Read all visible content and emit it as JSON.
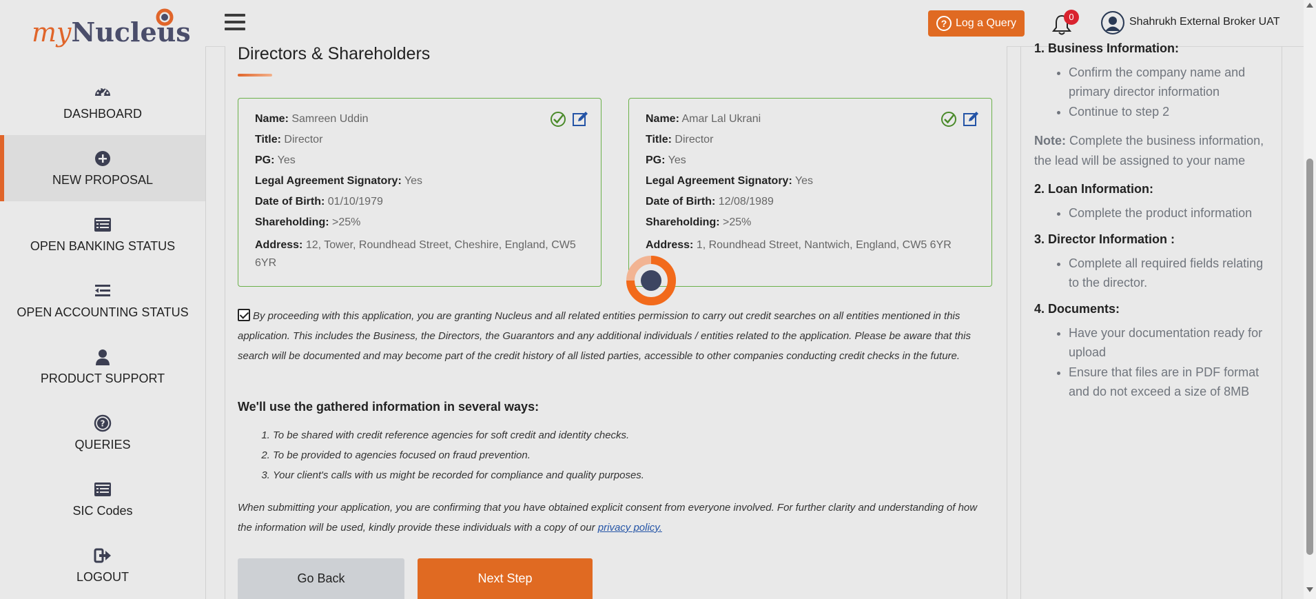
{
  "logo": {
    "part1": "my",
    "part2": "Nucleus"
  },
  "nav": [
    {
      "label": "DASHBOARD",
      "icon": "gauge-icon",
      "active": false
    },
    {
      "label": "NEW PROPOSAL",
      "icon": "plus-circle-icon",
      "active": true
    },
    {
      "label": "OPEN BANKING STATUS",
      "icon": "list-card-icon",
      "active": false
    },
    {
      "label": "OPEN ACCOUNTING STATUS",
      "icon": "indent-list-icon",
      "active": false
    },
    {
      "label": "PRODUCT SUPPORT",
      "icon": "user-icon",
      "active": false
    },
    {
      "label": "QUERIES",
      "icon": "question-circle-icon",
      "active": false
    },
    {
      "label": "SIC Codes",
      "icon": "list-card-icon",
      "active": false
    },
    {
      "label": "LOGOUT",
      "icon": "sign-out-icon",
      "active": false
    }
  ],
  "topbar": {
    "query_label": "Log a Query",
    "notification_count": "0",
    "user_name": "Shahrukh External Broker UAT"
  },
  "page": {
    "title": "Directors & Shareholders"
  },
  "labels": {
    "name": "Name:",
    "title": "Title:",
    "pg": "PG:",
    "signatory": "Legal Agreement Signatory:",
    "dob": "Date of Birth:",
    "shareholding": "Shareholding:",
    "address": "Address:"
  },
  "directors": [
    {
      "name": "Samreen Uddin",
      "title": "Director",
      "pg": "Yes",
      "signatory": "Yes",
      "dob": "01/10/1979",
      "shareholding": ">25%",
      "address": "12, Tower, Roundhead Street, Cheshire, England, CW5 6YR"
    },
    {
      "name": "Amar Lal Ukrani",
      "title": "Director",
      "pg": "Yes",
      "signatory": "Yes",
      "dob": "12/08/1989",
      "shareholding": ">25%",
      "address": "1, Roundhead Street, Nantwich, England, CW5 6YR"
    }
  ],
  "consent": {
    "checked": true,
    "text": "By proceeding with this application, you are granting Nucleus and all related entities permission to carry out credit searches on all entities mentioned in this application. This includes the Business, the Directors, the Guarantors and any additional individuals / entities related to the application. Please be aware that this search will be documented and may become part of the credit history of all listed parties, accessible to other companies conducting credit checks in the future."
  },
  "ways": {
    "title": "We'll use the gathered information in several ways:",
    "items": [
      "To be shared with credit reference agencies for soft credit and identity checks.",
      "To be provided to agencies focused on fraud prevention.",
      "Your client's calls with us might be recorded for compliance and quality purposes."
    ]
  },
  "submit": {
    "text": "When submitting your application, you are confirming that you have obtained explicit consent from everyone involved. For further clarity and understanding of how the information will be used, kindly provide these individuals with a copy of our ",
    "link": "privacy policy."
  },
  "buttons": {
    "back": "Go Back",
    "next": "Next Step"
  },
  "guide": {
    "s1": "1. Business Information:",
    "s1_items": [
      "Confirm the company name and primary director information",
      "Continue to step 2"
    ],
    "note_label": "Note:",
    "note_text": " Complete the business information, the lead will be assigned to your name",
    "s2": "2. Loan Information:",
    "s2_items": [
      "Complete the product information"
    ],
    "s3": "3. Director Information :",
    "s3_items": [
      "Complete all required fields relating to the director."
    ],
    "s4": "4. Documents:",
    "s4_items": [
      "Have your documentation ready for upload",
      "Ensure that files are in PDF format and do not exceed a size of 8MB"
    ]
  },
  "colors": {
    "accent": "#e06a22",
    "card_border": "#6bb04a",
    "badge": "#d9232f"
  }
}
